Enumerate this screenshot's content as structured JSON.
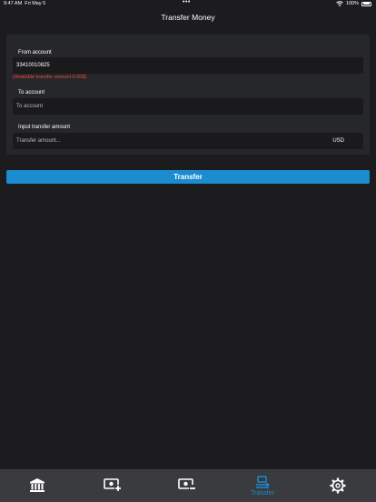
{
  "status_bar": {
    "time": "9:47 AM",
    "date": "Fri May 5",
    "dots": "•••",
    "battery_pct": "100%"
  },
  "header": {
    "title": "Transfer Money"
  },
  "form": {
    "from_account_label": "From account",
    "from_account_value": "33410010825",
    "available_warning": "(Available transfer amount 0.00$)",
    "to_account_label": "To account",
    "to_account_placeholder": "To account",
    "amount_label": "Input transfer amount",
    "amount_placeholder": "Transfer amount...",
    "currency": "USD"
  },
  "actions": {
    "transfer_label": "Transfer"
  },
  "tab_bar": {
    "items": [
      {
        "icon": "bank-icon",
        "label": ""
      },
      {
        "icon": "deposit-icon",
        "label": ""
      },
      {
        "icon": "withdraw-icon",
        "label": ""
      },
      {
        "icon": "transfer-icon",
        "label": "Transfer",
        "active": true
      },
      {
        "icon": "gear-icon",
        "label": ""
      }
    ]
  },
  "colors": {
    "background": "#1c1c1e",
    "card": "#26272b",
    "input": "#1a1a1d",
    "accent": "#1a8ccf",
    "warning": "#e44c3c",
    "tab_bar": "#3a3b3f"
  }
}
